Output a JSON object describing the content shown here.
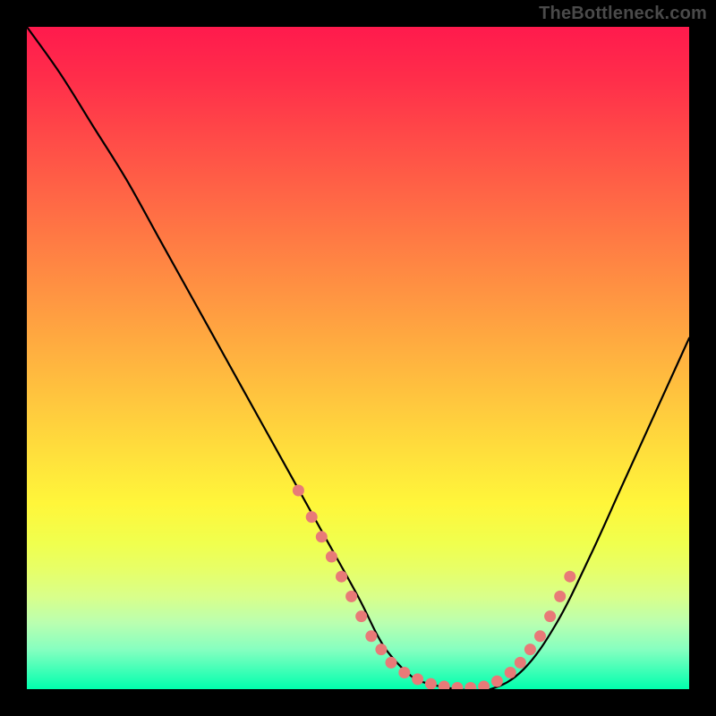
{
  "watermark": "TheBottleneck.com",
  "chart_data": {
    "type": "line",
    "title": "",
    "xlabel": "",
    "ylabel": "",
    "xlim": [
      0,
      100
    ],
    "ylim": [
      0,
      100
    ],
    "grid": false,
    "legend": false,
    "series": [
      {
        "name": "bottleneck-curve",
        "color": "#000000",
        "x": [
          0,
          5,
          10,
          15,
          20,
          25,
          30,
          35,
          40,
          45,
          50,
          53,
          55,
          58,
          60,
          65,
          70,
          75,
          80,
          85,
          90,
          95,
          100
        ],
        "y_percent": [
          100,
          93,
          85,
          77,
          68,
          59,
          50,
          41,
          32,
          23,
          14,
          8,
          5,
          2,
          1,
          0,
          0,
          3,
          10,
          20,
          31,
          42,
          53
        ]
      },
      {
        "name": "highlight-dots",
        "color": "#e87a78",
        "points": [
          {
            "x": 41,
            "y_percent": 30
          },
          {
            "x": 43,
            "y_percent": 26
          },
          {
            "x": 44.5,
            "y_percent": 23
          },
          {
            "x": 46,
            "y_percent": 20
          },
          {
            "x": 47.5,
            "y_percent": 17
          },
          {
            "x": 49,
            "y_percent": 14
          },
          {
            "x": 50.5,
            "y_percent": 11
          },
          {
            "x": 52,
            "y_percent": 8
          },
          {
            "x": 53.5,
            "y_percent": 6
          },
          {
            "x": 55,
            "y_percent": 4
          },
          {
            "x": 57,
            "y_percent": 2.5
          },
          {
            "x": 59,
            "y_percent": 1.5
          },
          {
            "x": 61,
            "y_percent": 0.8
          },
          {
            "x": 63,
            "y_percent": 0.4
          },
          {
            "x": 65,
            "y_percent": 0.2
          },
          {
            "x": 67,
            "y_percent": 0.2
          },
          {
            "x": 69,
            "y_percent": 0.4
          },
          {
            "x": 71,
            "y_percent": 1.2
          },
          {
            "x": 73,
            "y_percent": 2.5
          },
          {
            "x": 74.5,
            "y_percent": 4
          },
          {
            "x": 76,
            "y_percent": 6
          },
          {
            "x": 77.5,
            "y_percent": 8
          },
          {
            "x": 79,
            "y_percent": 11
          },
          {
            "x": 80.5,
            "y_percent": 14
          },
          {
            "x": 82,
            "y_percent": 17
          }
        ]
      }
    ]
  }
}
